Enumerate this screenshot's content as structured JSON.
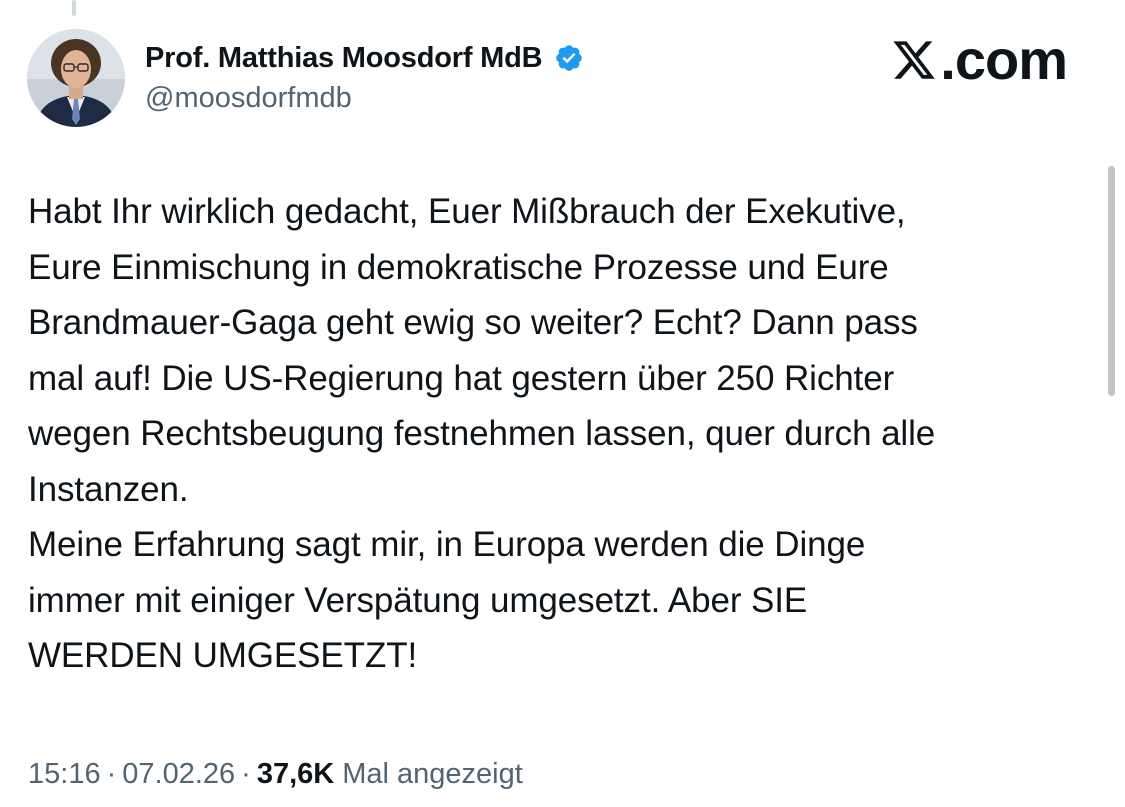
{
  "header": {
    "display_name": "Prof. Matthias Moosdorf MdB",
    "handle": "@moosdorfmdb",
    "verified_icon": "verified-badge-icon",
    "avatar_icon": "avatar-portrait",
    "brand_text": ".com",
    "brand_icon": "x-logo-icon",
    "accent_color": "#1d9bf0"
  },
  "tweet": {
    "lines": [
      "Habt Ihr wirklich gedacht, Euer Mißbrauch der Exekutive,",
      "Eure Einmischung in demokratische Prozesse und Eure",
      "Brandmauer-Gaga geht ewig so weiter? Echt? Dann pass",
      "mal auf! Die US-Regierung hat gestern über 250 Richter",
      "wegen Rechtsbeugung festnehmen lassen, quer durch alle",
      "Instanzen.",
      "Meine Erfahrung sagt mir, in Europa werden die Dinge",
      "immer mit einiger Verspätung umgesetzt. Aber SIE",
      "WERDEN UMGESETZT!"
    ]
  },
  "meta": {
    "time": "15:16",
    "separator": "·",
    "date": "07.02.26",
    "views": "37,6K",
    "views_label": "Mal angezeigt"
  }
}
